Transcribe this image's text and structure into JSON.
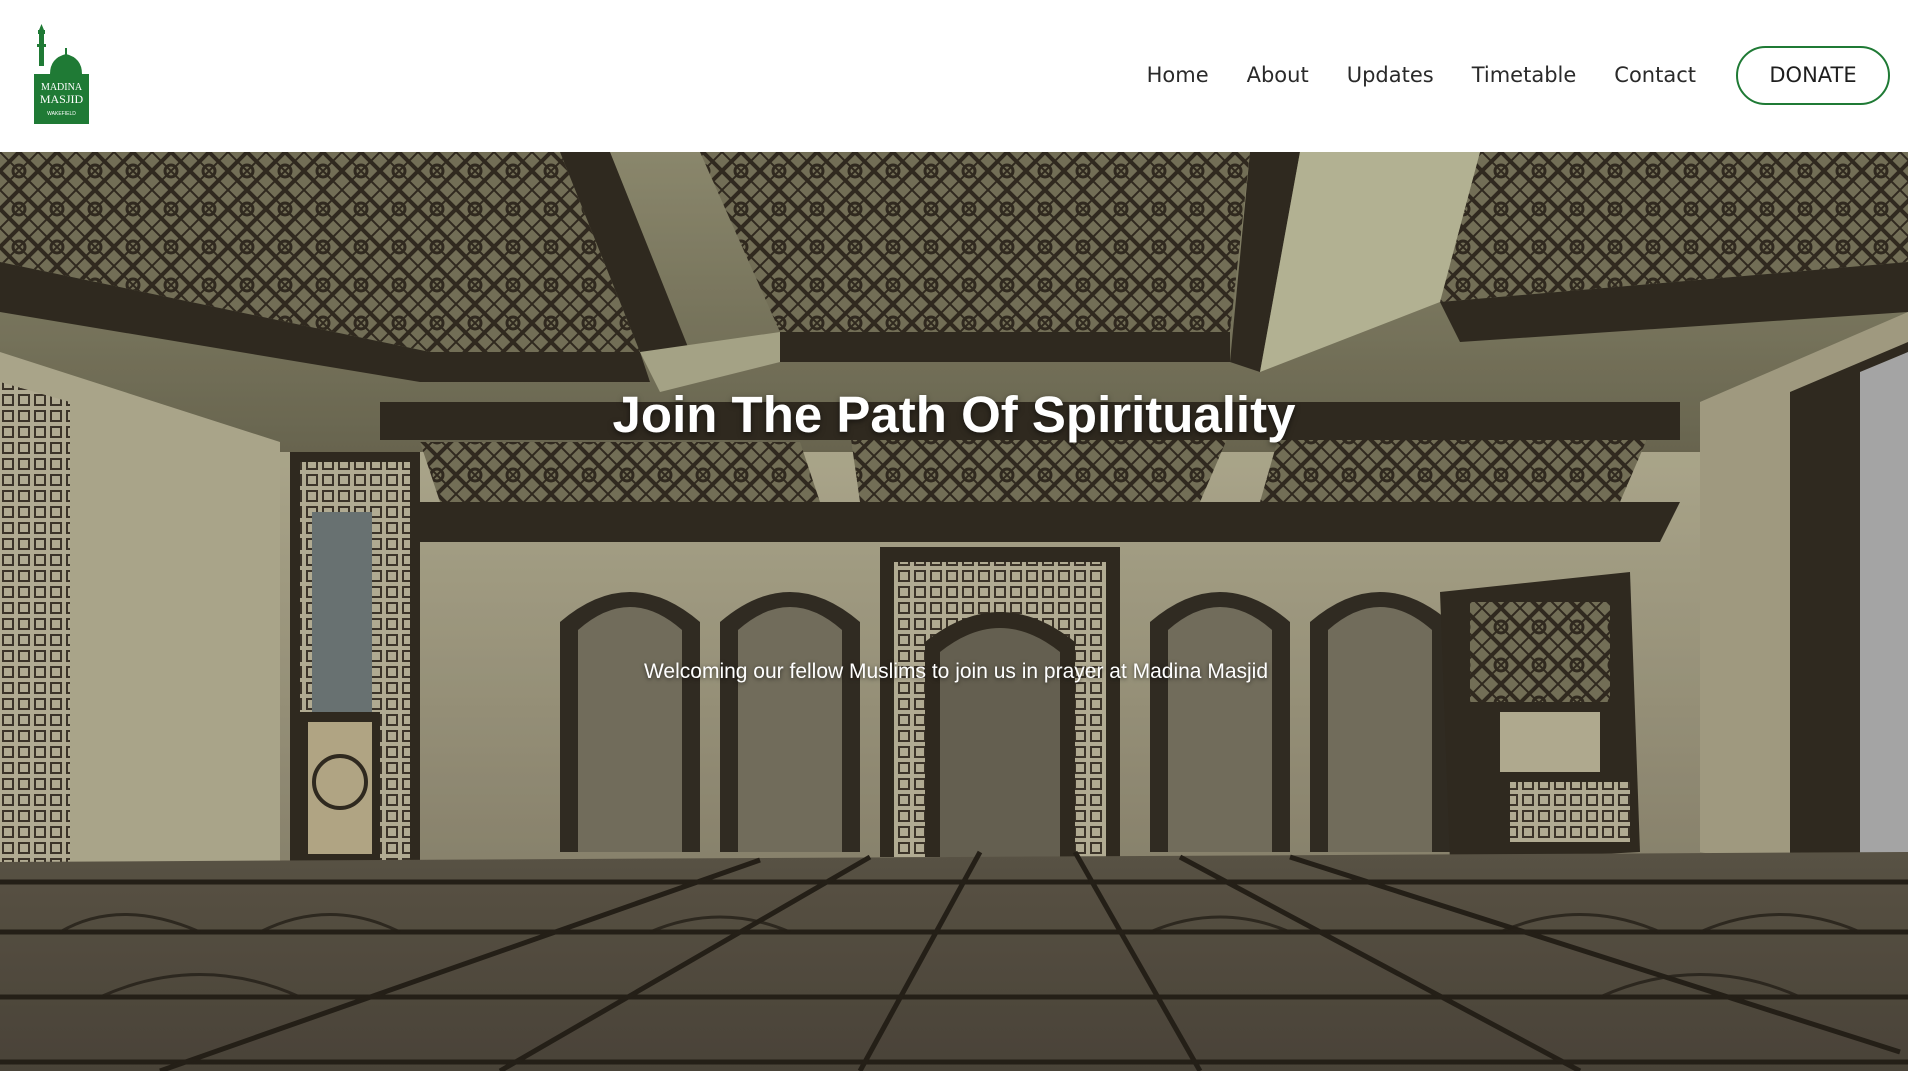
{
  "brand": {
    "logo_line1": "MADINA",
    "logo_line2": "MASJID",
    "logo_line3": "WAKEFIELD",
    "brand_color": "#1f7a35"
  },
  "nav": {
    "items": [
      {
        "label": "Home"
      },
      {
        "label": "About"
      },
      {
        "label": "Updates"
      },
      {
        "label": "Timetable"
      },
      {
        "label": "Contact"
      }
    ],
    "donate_label": "DONATE"
  },
  "hero": {
    "title": "Join The Path Of Spirituality",
    "subtitle": "Welcoming our fellow Muslims to join us in prayer at Madina Masjid",
    "background": "prayer-hall-interior-image"
  }
}
